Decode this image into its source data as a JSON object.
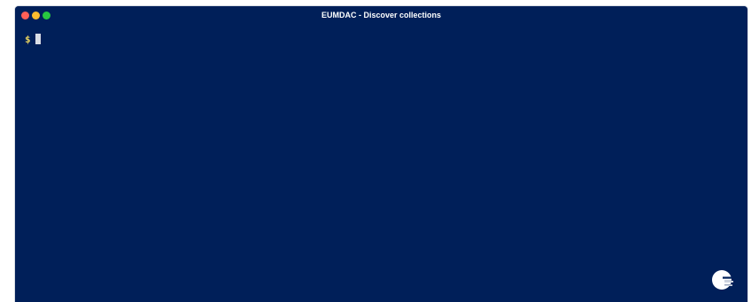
{
  "window": {
    "title": "EUMDAC - Discover collections",
    "background": "#001f59"
  },
  "traffic_lights": {
    "close": "#ff5f57",
    "minimize": "#febc2e",
    "maximize": "#28c840"
  },
  "terminal": {
    "prompt": "$",
    "input": "",
    "prompt_color": "#e6d160"
  },
  "icons": {
    "logo": "eumetsat-logo-icon"
  }
}
